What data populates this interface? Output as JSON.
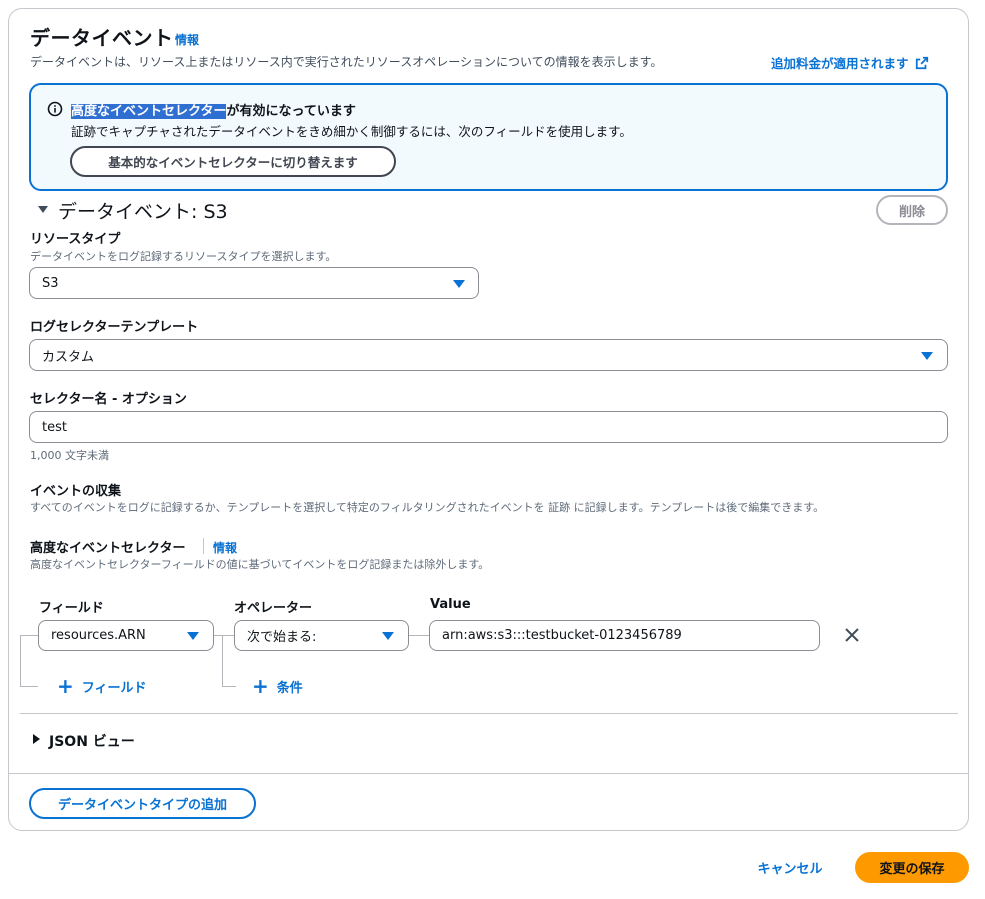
{
  "header": {
    "title": "データイベント",
    "info_label": "情報",
    "description": "データイベントは、リソース上またはリソース内で実行されたリソースオペレーションについての情報を表示します。",
    "pricing_link": "追加料金が適用されます",
    "pricing_link_icon": "external-link-icon"
  },
  "alert": {
    "icon": "info-icon",
    "title_highlight": "高度なイベントセレクター",
    "title_rest": "が有効になっています",
    "body": "証跡でキャプチャされたデータイベントをきめ細かく制御するには、次のフィールドを使用します。",
    "switch_button": "基本的なイベントセレクターに切り替えます",
    "accent_color": "#0972d3",
    "background_color": "#f2fafe"
  },
  "section": {
    "title": "データイベント: S3",
    "expanded": true,
    "delete_button": "削除"
  },
  "resource_type": {
    "label": "リソースタイプ",
    "description": "データイベントをログ記録するリソースタイプを選択します。",
    "value": "S3"
  },
  "log_selector_template": {
    "label": "ログセレクターテンプレート",
    "value": "カスタム"
  },
  "selector_name": {
    "label": "セレクター名 - オプション",
    "value": "test",
    "constraint": "1,000 文字未満"
  },
  "event_collection": {
    "label": "イベントの収集",
    "description": "すべてのイベントをログに記録するか、テンプレートを選択して特定のフィルタリングされたイベントを 証跡 に記録します。テンプレートは後で編集できます。"
  },
  "advanced_selectors": {
    "label": "高度なイベントセレクター",
    "info_label": "情報",
    "description": "高度なイベントセレクターフィールドの値に基づいてイベントをログ記録または除外します。",
    "columns": {
      "field": "フィールド",
      "operator": "オペレーター",
      "value": "Value"
    },
    "row": {
      "field": "resources.ARN",
      "operator": "次で始まる:",
      "value": "arn:aws:s3:::testbucket-0123456789"
    },
    "add_field": "フィールド",
    "add_condition": "条件",
    "remove_icon": "close-icon"
  },
  "json_view": {
    "label": "JSON ビュー",
    "expanded": false
  },
  "add_data_event_type": "データイベントタイプの追加",
  "footer": {
    "cancel": "キャンセル",
    "save": "変更の保存",
    "primary_color": "#ff9900"
  }
}
